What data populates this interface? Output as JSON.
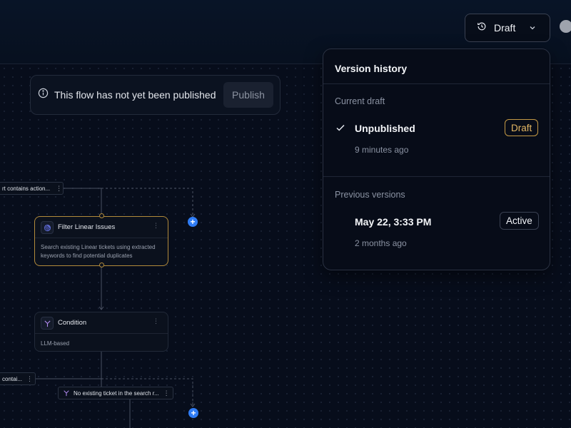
{
  "header": {
    "draft_label": "Draft"
  },
  "banner": {
    "message": "This flow has not yet been published",
    "publish_label": "Publish"
  },
  "version_history": {
    "title": "Version history",
    "current_section": "Current draft",
    "current": {
      "title": "Unpublished",
      "time": "9 minutes ago",
      "badge": "Draft"
    },
    "previous_section": "Previous versions",
    "previous": [
      {
        "title": "May 22, 3:33 PM",
        "time": "2 months ago",
        "badge": "Active"
      }
    ]
  },
  "flow": {
    "tag_top": "rt contains action...",
    "filter_node": {
      "title": "Filter Linear Issues",
      "desc_line1": "Search existing Linear tickets using extracted",
      "desc_line2": "keywords to find potential duplicates"
    },
    "condition_node": {
      "title": "Condition",
      "desc": "LLM-based"
    },
    "tag_left": "contai...",
    "tag_branch": "No existing ticket in the search r..."
  },
  "colors": {
    "accent_blue": "#2f7cf5",
    "draft_badge": "#c59a45",
    "selected_node_border": "#b28a3b",
    "background": "#060c1a"
  },
  "icons": {
    "history": "history-icon",
    "chevron": "chevron-down-icon",
    "info": "info-icon",
    "check": "check-icon",
    "linear": "linear-icon",
    "condition": "branch-icon",
    "more": "more-vertical-icon",
    "plus": "plus-icon"
  }
}
